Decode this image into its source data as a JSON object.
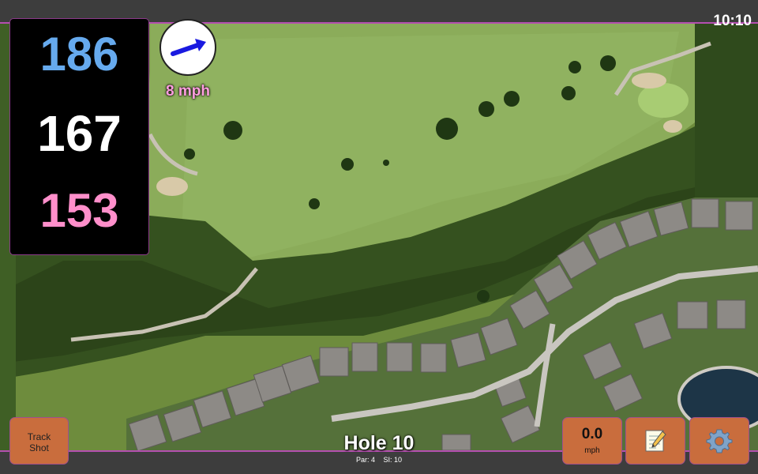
{
  "status": {
    "clock": "10:10"
  },
  "distances": {
    "back": "186",
    "middle": "167",
    "front": "153"
  },
  "wind": {
    "speed_label": "8 mph",
    "direction_icon": "wind-arrow-icon"
  },
  "hole": {
    "title": "Hole 10",
    "par": "Par: 4",
    "stroke_index": "SI: 10"
  },
  "buttons": {
    "track_shot": {
      "line1": "Track",
      "line2": "Shot"
    },
    "wind_speed": {
      "value": "0.0",
      "unit": "mph"
    },
    "scorecard": {
      "icon": "scorecard-note-icon"
    },
    "settings": {
      "icon": "gear-icon"
    }
  },
  "colors": {
    "accent": "#b44fb0",
    "button": "#c96d3d",
    "back": "#66aaee",
    "middle": "#ffffff",
    "front": "#ff8fcb"
  }
}
